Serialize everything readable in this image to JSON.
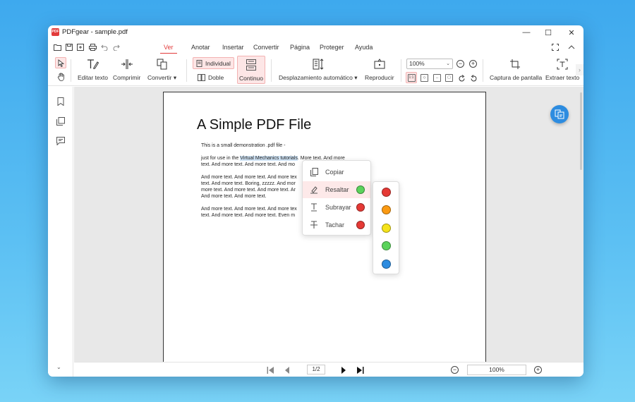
{
  "window": {
    "logo_text": "PDF",
    "title": "PDFgear - sample.pdf",
    "minimize": "—",
    "maximize": "☐",
    "close": "✕"
  },
  "menu": {
    "tabs": [
      "Ver",
      "Anotar",
      "Insertar",
      "Convertir",
      "Página",
      "Proteger",
      "Ayuda"
    ],
    "active_tab": "Ver"
  },
  "ribbon": {
    "edit_text": "Editar texto",
    "compress": "Comprimir",
    "convert": "Convertir",
    "single": "Individual",
    "double": "Doble",
    "continuous": "Continuo",
    "autoscroll": "Desplazamiento automático",
    "play": "Reproducir",
    "zoom": "100%",
    "screenshot": "Captura de pantalla",
    "extract_text": "Extraer texto"
  },
  "document": {
    "title": "A Simple PDF File",
    "line1": "This is a small demonstration .pdf file -",
    "p2_l1_pre": "just for use in the ",
    "p2_l1_hl": "Virtual Mechanics tutorials",
    "p2_l1_post": ". More text. And more",
    "p2_l2": "text. And more text. And more text. And mo",
    "p3_l1": "And more text. And more text. And more tex",
    "p3_l2": "text. And more text. Boring, zzzzz. And mor",
    "p3_l3": "more text. And more text. And more text. Ar",
    "p3_l4": "And more text. And more text.",
    "p4_l1": "And more text. And more text. And more tex",
    "p4_l2": "text. And more text. And more text. Even m"
  },
  "context_menu": {
    "copy": "Copiar",
    "highlight": "Resaltar",
    "underline": "Subrayar",
    "strike": "Tachar",
    "highlight_color": "#5bd35b",
    "underline_color": "#e53935",
    "strike_color": "#e53935"
  },
  "palette": {
    "colors": [
      "#e53935",
      "#fb9a12",
      "#f5e31b",
      "#5bd35b",
      "#2d8ce0"
    ]
  },
  "bottom": {
    "page": "1/2",
    "zoom": "100%"
  },
  "theme": {
    "accent": "#e23b3b",
    "fab": "#2d8ce0"
  }
}
